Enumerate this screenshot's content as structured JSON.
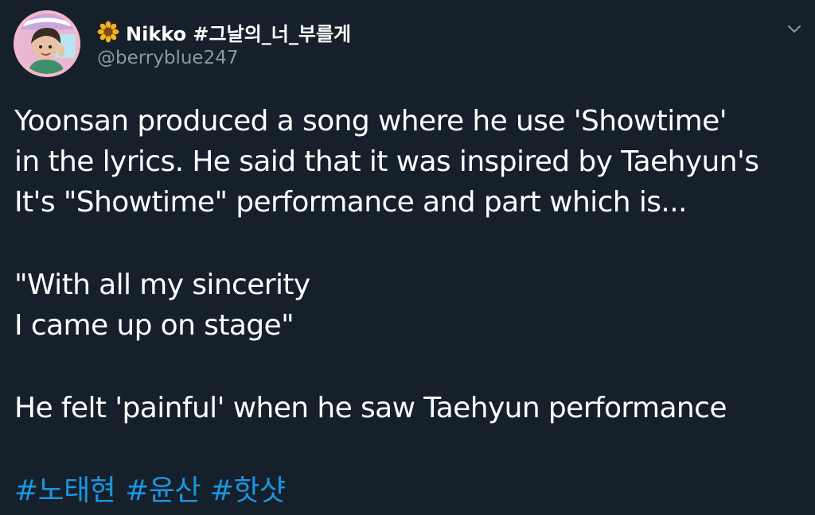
{
  "author": {
    "name": "Nikko #그날의_너_부를게",
    "handle": "@berryblue247",
    "name_icon": "sunflower-icon",
    "avatar_icon": "profile-photo"
  },
  "tweet": {
    "lines": [
      "Yoonsan produced a song where he use 'Showtime'",
      "in the lyrics. He said that it was inspired by Taehyun's",
      "It's \"Showtime\" performance and part which is...",
      "\"With all my sincerity",
      "I came up on stage\"",
      "He felt 'painful' when he saw Taehyun performance"
    ],
    "hashtags": [
      "#노태현",
      "#윤산",
      "#핫샷"
    ]
  },
  "menu": {
    "icon": "chevron-down-icon"
  },
  "colors": {
    "background": "#15202b",
    "text": "#ffffff",
    "secondary_text": "#8899a6",
    "link": "#1b95e0"
  }
}
